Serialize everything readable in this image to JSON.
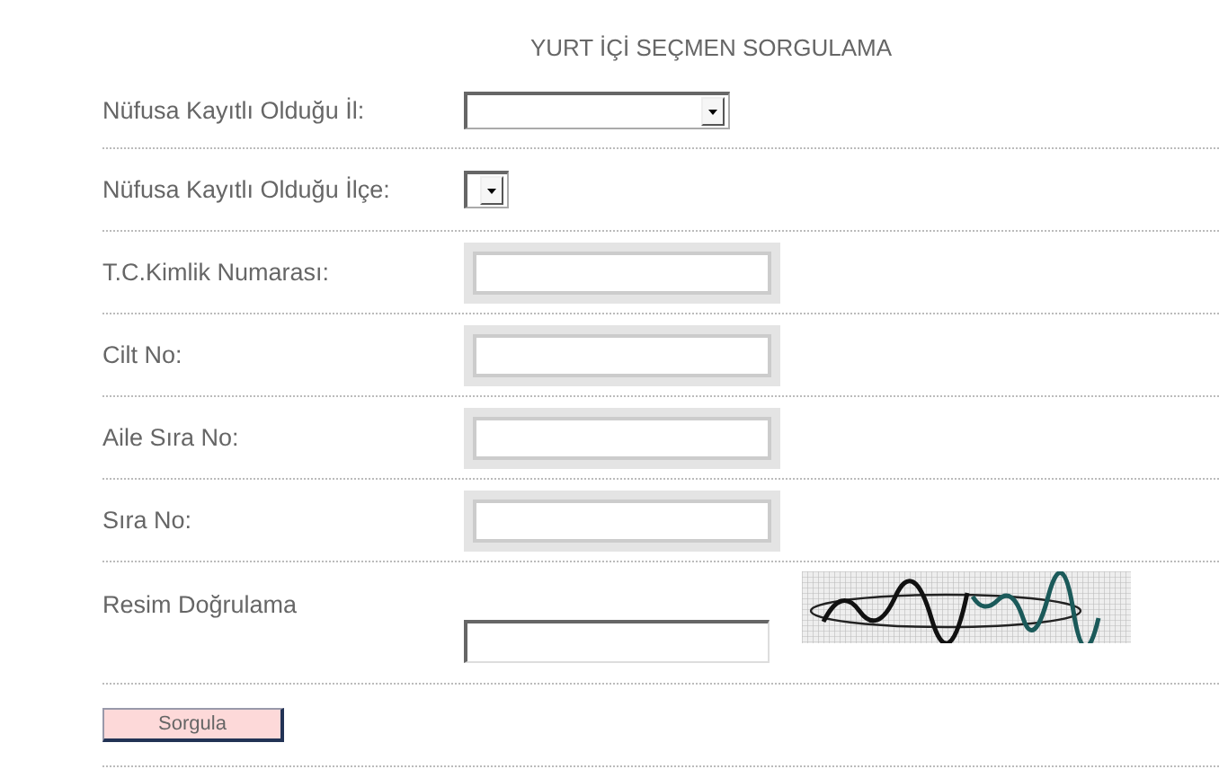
{
  "title": "YURT İÇİ SEÇMEN SORGULAMA",
  "fields": [
    {
      "label": "Nüfusa Kayıtlı Olduğu İl:",
      "kind": "select-wide"
    },
    {
      "label": "Nüfusa Kayıtlı Olduğu İlçe:",
      "kind": "select-narrow"
    },
    {
      "label": "T.C.Kimlik Numarası:",
      "kind": "text"
    },
    {
      "label": "Cilt No:",
      "kind": "text"
    },
    {
      "label": "Aile Sıra No:",
      "kind": "text"
    },
    {
      "label": "Sıra No:",
      "kind": "text"
    },
    {
      "label": "Resim Doğrulama",
      "kind": "captcha"
    }
  ],
  "submit": "Sorgula"
}
